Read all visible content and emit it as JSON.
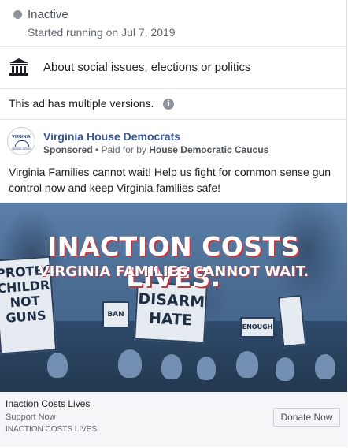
{
  "status": {
    "state": "Inactive",
    "started": "Started running on Jul 7, 2019"
  },
  "category": {
    "icon": "bank-icon",
    "text": "About social issues, elections or politics"
  },
  "versions": {
    "text": "This ad has multiple versions.",
    "icon": "info-icon",
    "icon_glyph": "i"
  },
  "advertiser": {
    "name": "Virginia House Democrats",
    "sponsored": "Sponsored",
    "paid_for_prefix": "• Paid for by",
    "payer": "House Democratic Caucus",
    "logo_text": "VIRGINIA",
    "logo_subtext": "HOUSE DEMS"
  },
  "ad_copy": "Virginia Families cannot wait! Help us fight for common sense gun control now and keep Virginia families safe!",
  "creative": {
    "headline": "INACTION COSTS LIVES.",
    "subheadline": "VIRGINIA FAMILIES CANNOT WAIT.",
    "signs": {
      "protect": "PROTECT CHILDREN NOT GUNS",
      "disarm": "DISARM HATE",
      "ban": "BAN",
      "enough": "ENOUGH"
    }
  },
  "footer": {
    "title": "Inaction Costs Lives",
    "subtitle": "Support Now",
    "caption": "INACTION COSTS LIVES",
    "cta": "Donate Now"
  },
  "colors": {
    "link": "#385898",
    "status_dot": "#8d949e",
    "headline_shadow": "#c8373c"
  }
}
